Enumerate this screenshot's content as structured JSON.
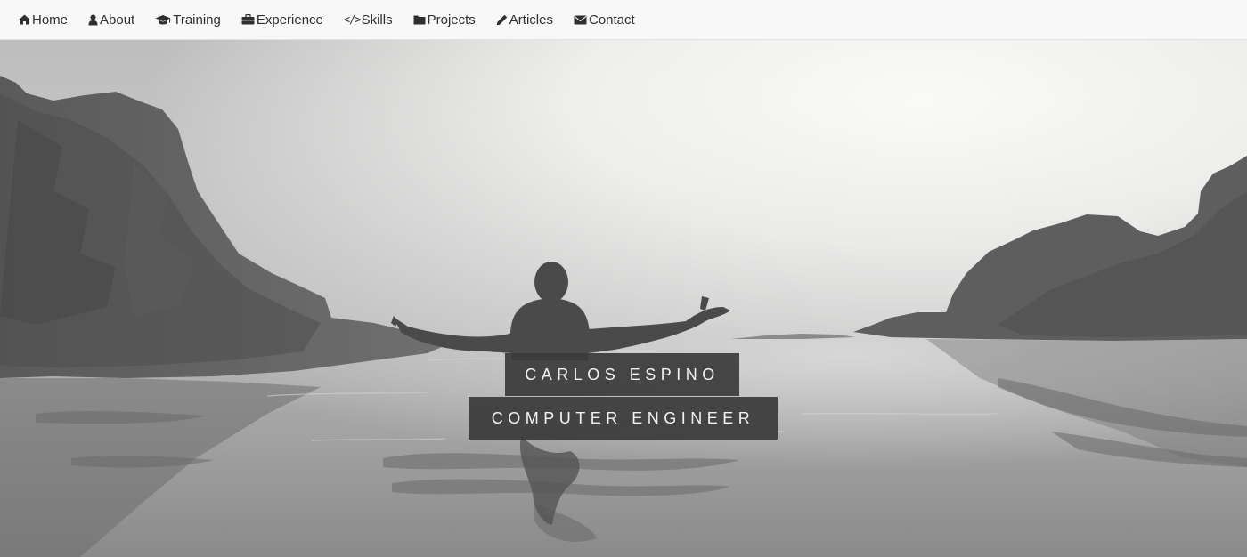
{
  "nav": {
    "items": [
      {
        "label": "Home",
        "icon": "home-icon"
      },
      {
        "label": "About",
        "icon": "user-icon"
      },
      {
        "label": "Training",
        "icon": "graduation-cap-icon"
      },
      {
        "label": "Experience",
        "icon": "briefcase-icon"
      },
      {
        "label": "Skills",
        "icon": "code-icon"
      },
      {
        "label": "Projects",
        "icon": "folder-icon"
      },
      {
        "label": "Articles",
        "icon": "pencil-icon"
      },
      {
        "label": "Contact",
        "icon": "envelope-icon"
      }
    ],
    "background": "#f8f8f8",
    "text_color": "#2f2f2f"
  },
  "hero": {
    "name": "CARLOS ESPINO",
    "title": "COMPUTER ENGINEER",
    "label_background": "#3a3a3a",
    "label_text_color": "#f2f2f2",
    "image": "grayscale photo of a man standing in the sea with arms outstretched between rocky cliffs"
  }
}
